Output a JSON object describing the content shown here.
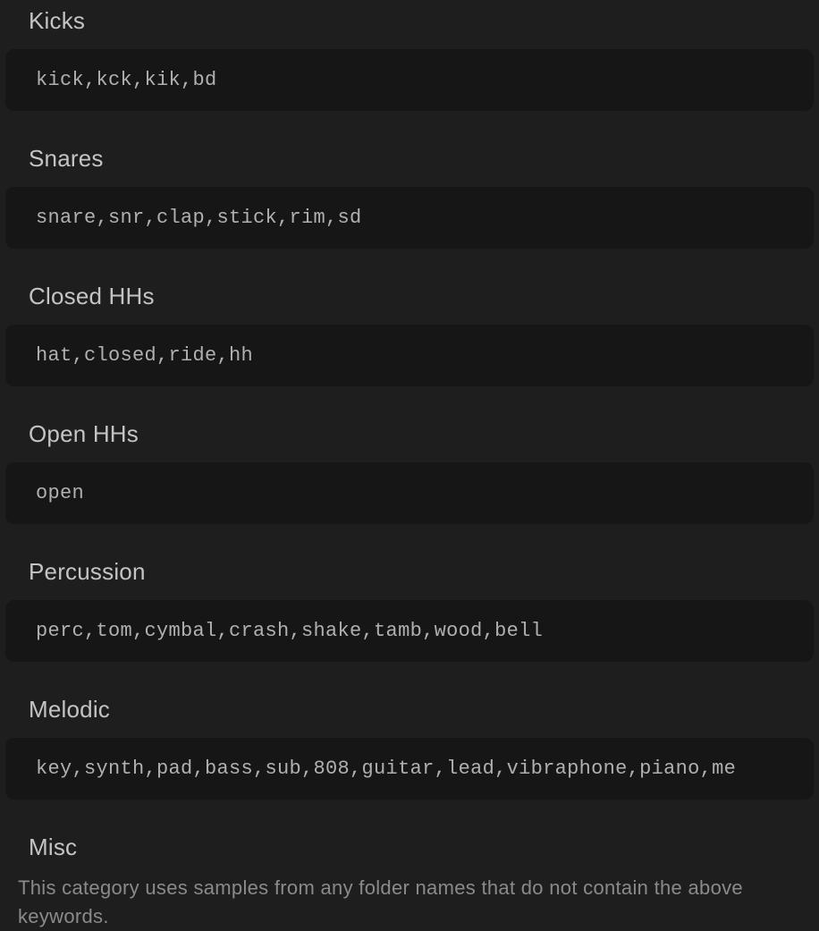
{
  "categories": {
    "kicks": {
      "label": "Kicks",
      "value": "kick,kck,kik,bd"
    },
    "snares": {
      "label": "Snares",
      "value": "snare,snr,clap,stick,rim,sd"
    },
    "closed_hhs": {
      "label": "Closed HHs",
      "value": "hat,closed,ride,hh"
    },
    "open_hhs": {
      "label": "Open HHs",
      "value": "open"
    },
    "percussion": {
      "label": "Percussion",
      "value": "perc,tom,cymbal,crash,shake,tamb,wood,bell"
    },
    "melodic": {
      "label": "Melodic",
      "value": "key,synth,pad,bass,sub,808,guitar,lead,vibraphone,piano,me"
    },
    "misc": {
      "label": "Misc",
      "description": "This category uses samples from any folder names that do not contain the above keywords."
    }
  }
}
